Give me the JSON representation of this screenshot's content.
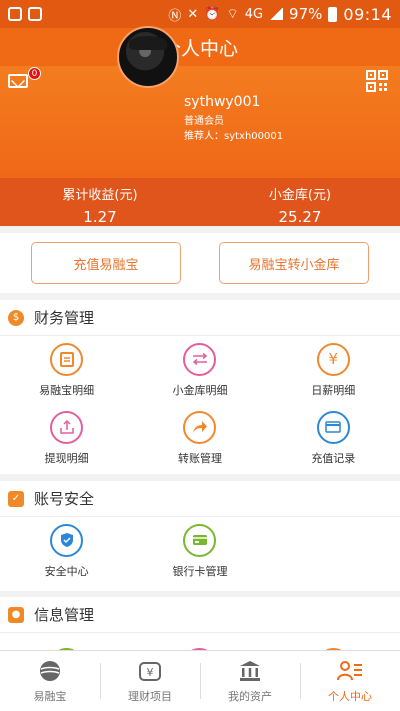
{
  "status_bar": {
    "time": "09:14",
    "battery": "97%",
    "network": "4G"
  },
  "title": "个人中心",
  "profile": {
    "username": "sythwy001",
    "level": "普通会员",
    "referrer": "推荐人：sytxh00001",
    "message_badge": "0"
  },
  "stats": [
    {
      "label": "累计收益(元)",
      "value": "1.27"
    },
    {
      "label": "小金库(元)",
      "value": "25.27"
    }
  ],
  "actions": {
    "recharge": "充值易融宝",
    "transfer": "易融宝转小金库"
  },
  "sections": {
    "finance": {
      "title": "财务管理",
      "items": [
        {
          "label": "易融宝明细",
          "icon": "clipboard-icon",
          "color": "#f0892e"
        },
        {
          "label": "小金库明细",
          "icon": "exchange-icon",
          "color": "#e45e9e"
        },
        {
          "label": "日薪明细",
          "icon": "yuan-refresh-icon",
          "color": "#f0892e"
        },
        {
          "label": "提现明细",
          "icon": "upload-icon",
          "color": "#e45e9e"
        },
        {
          "label": "转账管理",
          "icon": "forward-arrow-icon",
          "color": "#f0892e"
        },
        {
          "label": "充值记录",
          "icon": "card-icon",
          "color": "#2d87d6"
        }
      ]
    },
    "security": {
      "title": "账号安全",
      "items": [
        {
          "label": "安全中心",
          "icon": "shield-check-icon",
          "color": "#2d87d6"
        },
        {
          "label": "银行卡管理",
          "icon": "bank-card-icon",
          "color": "#79b82c"
        }
      ]
    },
    "info": {
      "title": "信息管理"
    }
  },
  "tabs": [
    {
      "label": "易融宝",
      "icon": "globe-icon"
    },
    {
      "label": "理财项目",
      "icon": "yuan-box-icon"
    },
    {
      "label": "我的资产",
      "icon": "bank-building-icon"
    },
    {
      "label": "个人中心",
      "icon": "person-list-icon"
    }
  ],
  "colors": {
    "accent": "#f06a16",
    "header_bg": "#e25a12",
    "stats_bg": "#e0551b"
  }
}
